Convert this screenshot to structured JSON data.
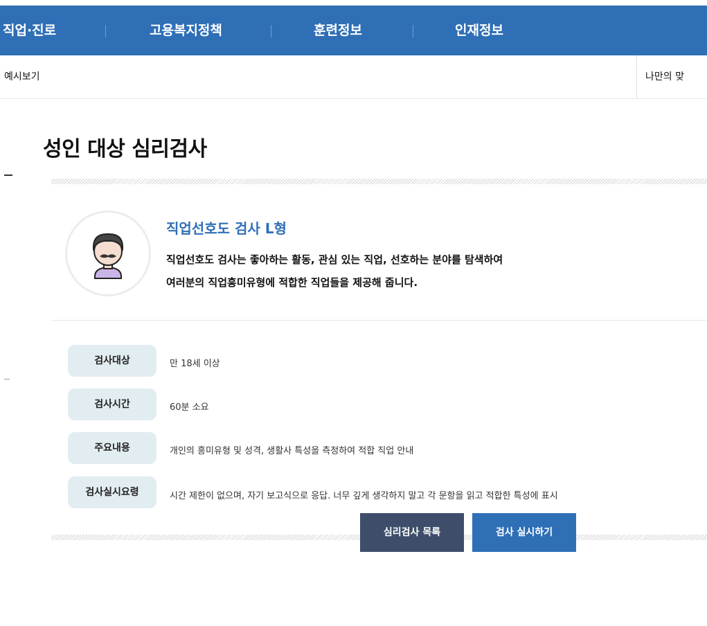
{
  "topnav": {
    "items": [
      "직업·진로",
      "고용복지정책",
      "훈련정보",
      "인재정보"
    ]
  },
  "subbar": {
    "left": "예시보기",
    "right": "나만의 맞"
  },
  "page": {
    "title": "성인 대상 심리검사"
  },
  "test": {
    "name": "직업선호도 검사 L형",
    "desc1": "직업선호도 검사는 좋아하는 활동, 관심 있는 직업, 선호하는 분야를 탐색하여",
    "desc2": "여러분의 직업흥미유형에 적합한 직업들을 제공해 줍니다."
  },
  "info": [
    {
      "label": "검사대상",
      "value": "만 18세 이상"
    },
    {
      "label": "검사시간",
      "value": "60분 소요"
    },
    {
      "label": "주요내용",
      "value": "개인의 흥미유형 및 성격, 생활사 특성을 측정하여 적합 직업 안내"
    },
    {
      "label": "검사실시요령",
      "value": "시간 제한이 없으며, 자기 보고식으로 응답. 너무 깊게 생각하지 말고 각 문항을 읽고 적합한 특성에 표시"
    }
  ],
  "buttons": {
    "list": "심리검사 목록",
    "start": "검사 실시하기"
  },
  "icons": {
    "avatar": "person-avatar-icon"
  },
  "colors": {
    "nav": "#2f6fb6",
    "label_bg": "#e2edf1",
    "list_button": "#3e4e6a",
    "start_button": "#2f6fb6"
  }
}
